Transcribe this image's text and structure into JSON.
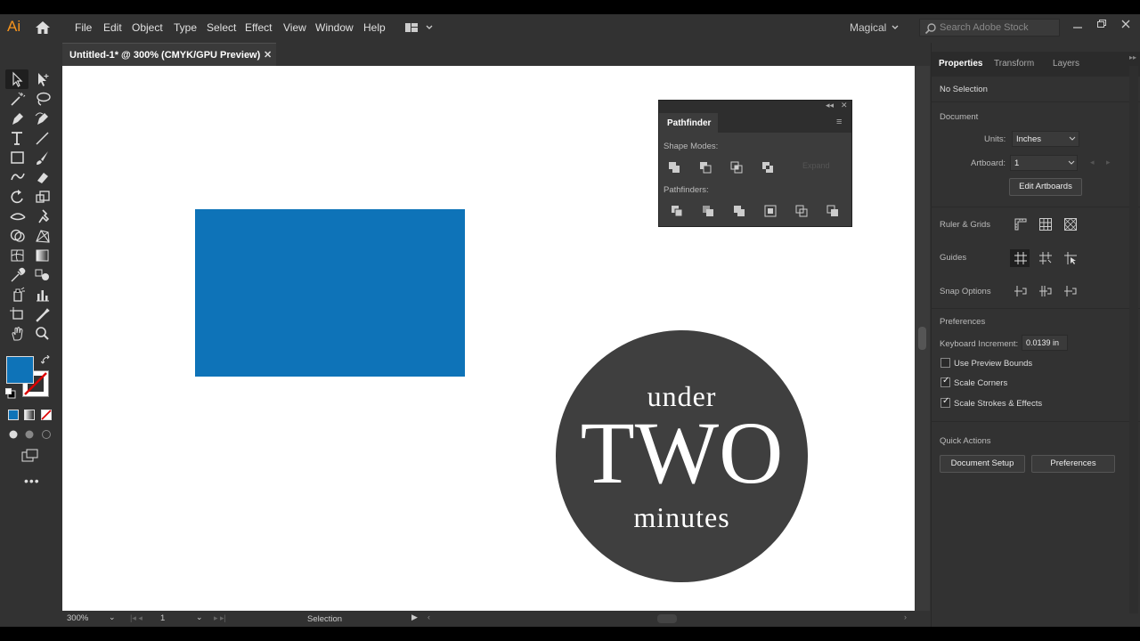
{
  "app": {
    "logo": "Ai",
    "workspace": "Magical",
    "search_placeholder": "Search Adobe Stock"
  },
  "menu": [
    "File",
    "Edit",
    "Object",
    "Type",
    "Select",
    "Effect",
    "View",
    "Window",
    "Help"
  ],
  "document": {
    "tab_title": "Untitled-1* @ 300% (CMYK/GPU Preview)"
  },
  "artwork": {
    "circle_line1": "under",
    "circle_line2": "TWO",
    "circle_line3": "minutes",
    "rect_color": "#0e73b8",
    "circle_color": "#3f3f3f"
  },
  "pathfinder": {
    "title": "Pathfinder",
    "shape_modes_label": "Shape Modes:",
    "pathfinders_label": "Pathfinders:",
    "expand_label": "Expand"
  },
  "properties": {
    "tabs": [
      "Properties",
      "Transform",
      "Layers"
    ],
    "selection": "No Selection",
    "document_header": "Document",
    "units_label": "Units:",
    "units_value": "Inches",
    "artboard_label": "Artboard:",
    "artboard_value": "1",
    "edit_artboards": "Edit Artboards",
    "ruler_grids": "Ruler & Grids",
    "guides": "Guides",
    "snap_options": "Snap Options",
    "preferences_header": "Preferences",
    "keyboard_increment_label": "Keyboard Increment:",
    "keyboard_increment_value": "0.0139 in",
    "use_preview_bounds": "Use Preview Bounds",
    "use_preview_bounds_checked": false,
    "scale_corners": "Scale Corners",
    "scale_corners_checked": true,
    "scale_strokes": "Scale Strokes & Effects",
    "scale_strokes_checked": true,
    "quick_actions": "Quick Actions",
    "document_setup": "Document Setup",
    "preferences_button": "Preferences"
  },
  "status": {
    "zoom": "300%",
    "artboard": "1",
    "tool": "Selection"
  }
}
